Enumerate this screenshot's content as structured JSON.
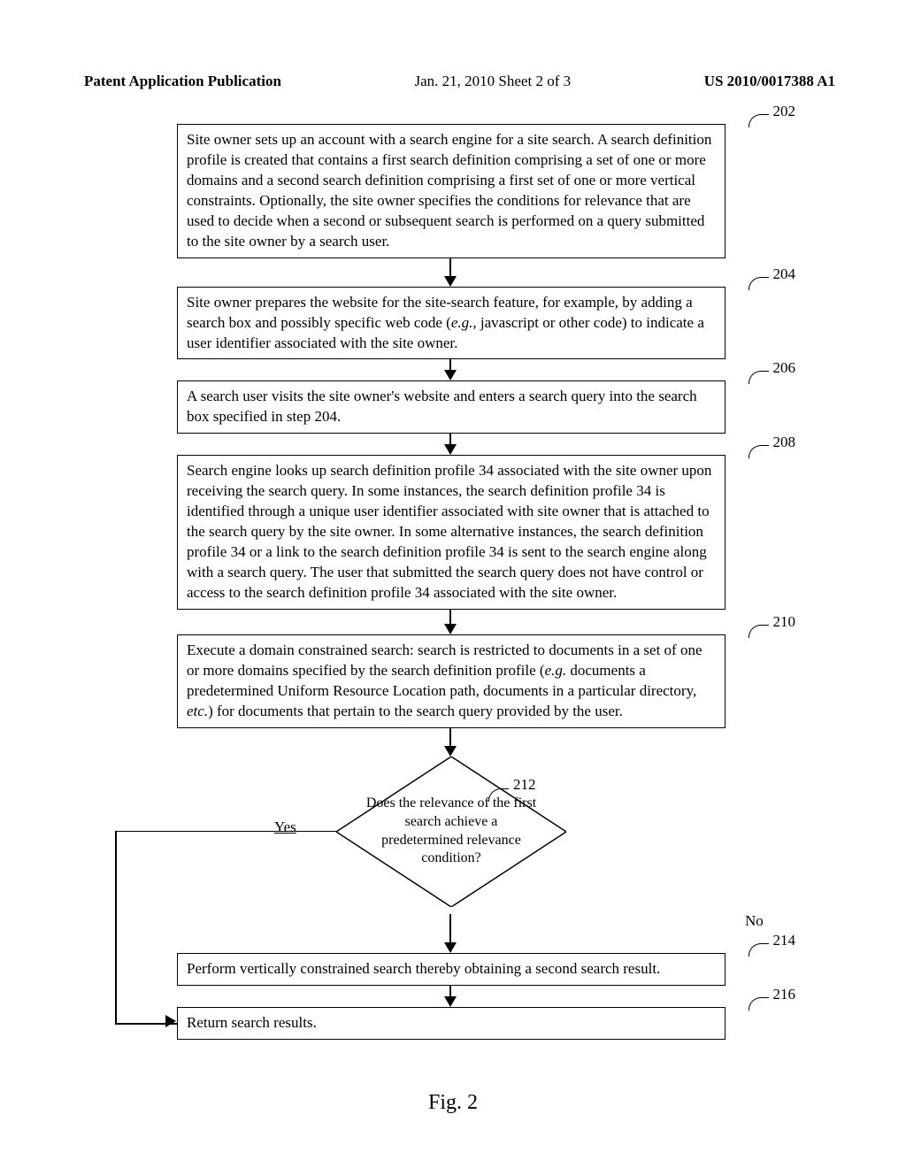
{
  "header": {
    "left": "Patent Application Publication",
    "center": "Jan. 21, 2010  Sheet 2 of 3",
    "right": "US 2010/0017388 A1"
  },
  "steps": {
    "s202": {
      "ref": "202",
      "text": "Site owner sets up an account with a search engine for a site search.  A search definition profile is created that contains a first search definition comprising a set of one or more domains and a second search definition comprising a first set of one or more vertical constraints.  Optionally, the site owner specifies the conditions for relevance that are used to decide when a second or subsequent search is performed on a query submitted to the site owner by a search user."
    },
    "s204": {
      "ref": "204",
      "text_before": "Site owner prepares the website for the site-search feature, for example, by adding a search box and possibly specific web code (",
      "eg": "e.g.",
      "text_after": ", javascript or other code) to indicate a user identifier associated with the site owner."
    },
    "s206": {
      "ref": "206",
      "text": "A search user visits the site owner's website and enters a search query into the search box specified in step 204."
    },
    "s208": {
      "ref": "208",
      "text": "Search engine looks up search definition profile 34 associated with the site owner upon receiving the search query.  In some instances, the search definition profile 34 is identified through a unique user identifier associated with site owner that is attached to the search query by the site owner.  In some alternative instances, the search definition profile 34 or a link to the search definition profile 34 is sent to the search engine along with a search query.  The user that submitted the search query does not have control or access to the search definition profile 34 associated with the site owner."
    },
    "s210": {
      "ref": "210",
      "text_before": "Execute a domain constrained search:  search is restricted to documents in a set of one or more domains specified by the search definition profile (",
      "eg": "e.g.",
      "text_mid": " documents a predetermined Uniform Resource Location path, documents in a particular directory, ",
      "etc": "etc.",
      "text_after": ") for documents that pertain to the search query provided by the user."
    },
    "s212": {
      "ref": "212",
      "text": "Does the relevance of the first search achieve a predetermined relevance condition?",
      "yes": "Yes",
      "no": "No"
    },
    "s214": {
      "ref": "214",
      "text": "Perform vertically constrained search thereby obtaining a second search result."
    },
    "s216": {
      "ref": "216",
      "text": "Return search results."
    }
  },
  "figure_label": "Fig. 2"
}
